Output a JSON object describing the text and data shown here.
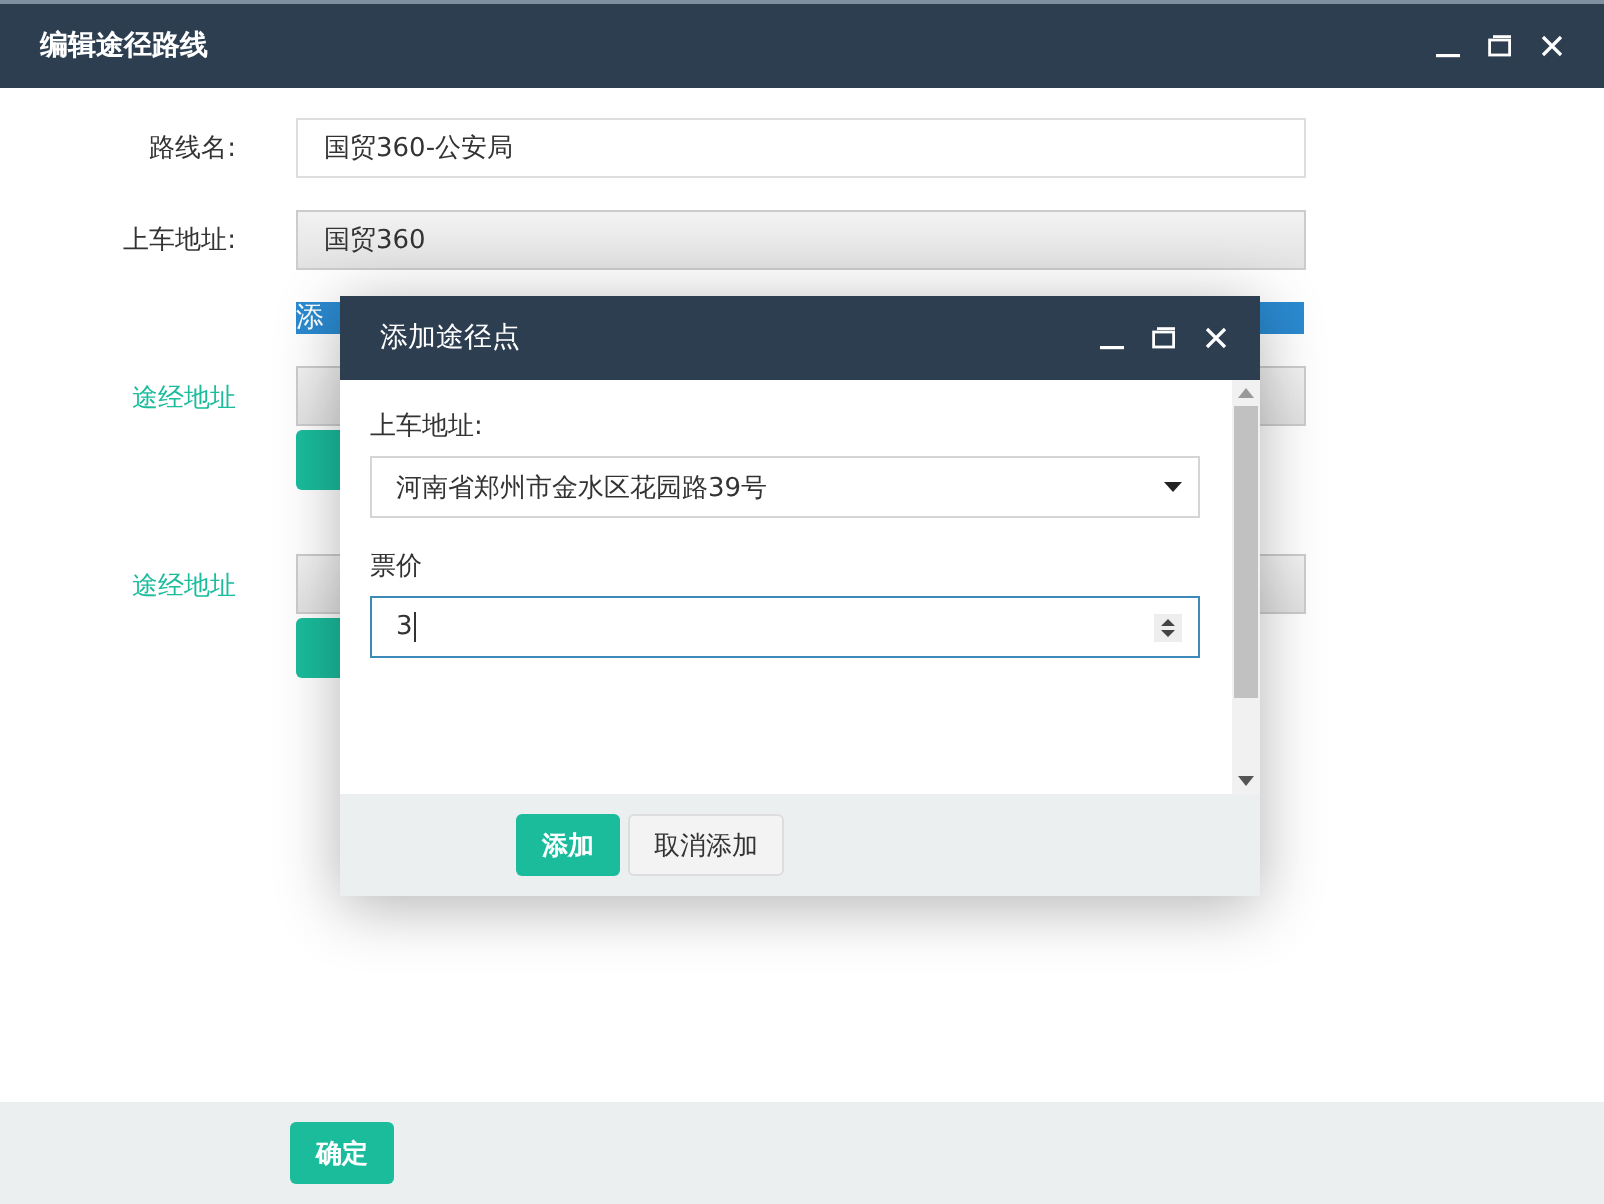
{
  "window": {
    "title": "编辑途径路线"
  },
  "form": {
    "route_name": {
      "label": "路线名:",
      "value": "国贸360-公安局",
      "disabled": false
    },
    "pickup": {
      "label": "上车地址:",
      "value": "国贸360",
      "disabled": true
    },
    "selected_text": "添",
    "waypoints": [
      {
        "label": "途经地址"
      },
      {
        "label": "途经地址"
      }
    ]
  },
  "footer": {
    "button": "确定"
  },
  "dialog": {
    "title": "添加途径点",
    "pickup": {
      "label": "上车地址:",
      "value": "河南省郑州市金水区花园路39号"
    },
    "fare": {
      "label": "票价",
      "value": "3",
      "focused": true
    },
    "buttons": [
      {
        "label": "添加",
        "kind": "primary"
      },
      {
        "label": "取消添加",
        "kind": "default"
      }
    ]
  }
}
